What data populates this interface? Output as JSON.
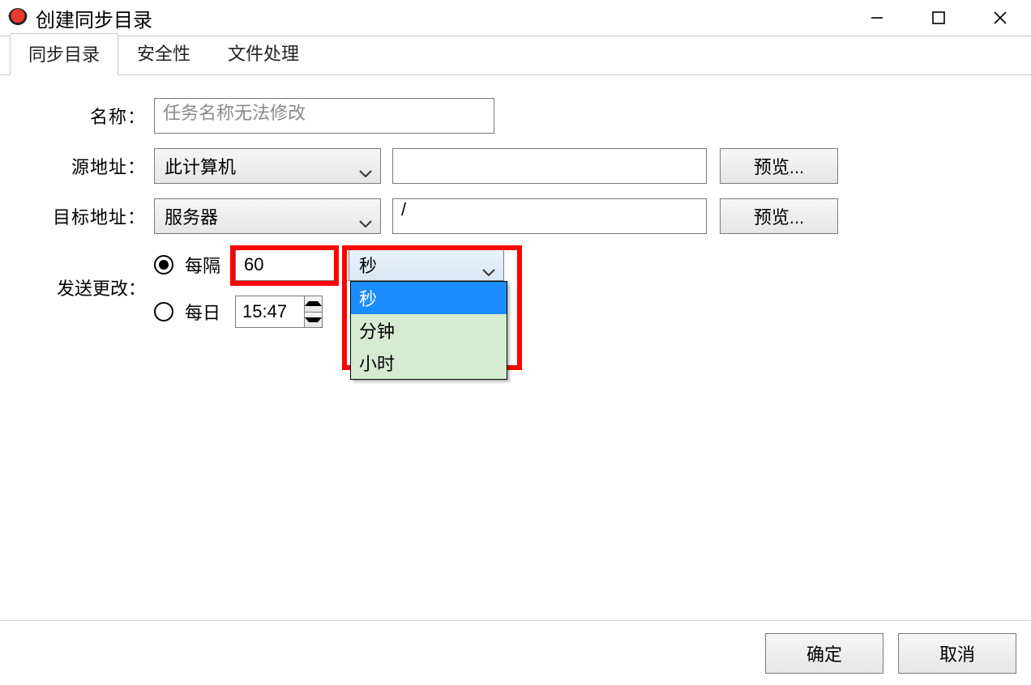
{
  "window": {
    "title": "创建同步目录"
  },
  "tabs": [
    {
      "label": "同步目录",
      "active": true
    },
    {
      "label": "安全性",
      "active": false
    },
    {
      "label": "文件处理",
      "active": false
    }
  ],
  "form": {
    "name": {
      "label": "名称：",
      "placeholder": "任务名称无法修改",
      "value": ""
    },
    "source": {
      "label": "源地址：",
      "combo": "此计算机",
      "path": "",
      "browse": "预览..."
    },
    "target": {
      "label": "目标地址：",
      "combo": "服务器",
      "path": "/",
      "browse": "预览..."
    },
    "schedule": {
      "label": "发送更改：",
      "selected": "interval",
      "interval": {
        "radio_label": "每隔",
        "value": "60",
        "unit_selected": "秒",
        "unit_options": [
          "秒",
          "分钟",
          "小时"
        ]
      },
      "daily": {
        "radio_label": "每日",
        "time": "15:47"
      }
    }
  },
  "footer": {
    "ok": "确定",
    "cancel": "取消"
  }
}
